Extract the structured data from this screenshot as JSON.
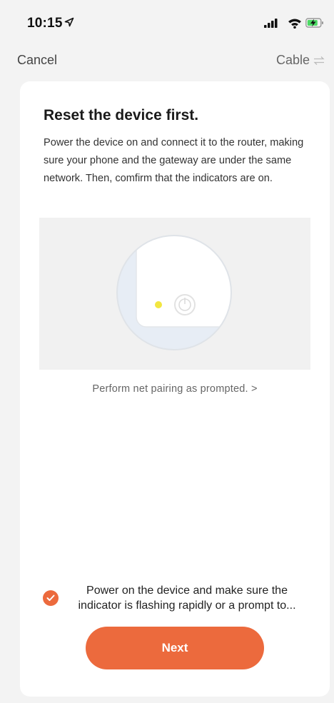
{
  "status_bar": {
    "time": "10:15",
    "location_icon": "location-arrow-icon",
    "signal_icon": "cellular-signal-icon",
    "wifi_icon": "wifi-icon",
    "battery_icon": "battery-charging-icon"
  },
  "nav": {
    "cancel_label": "Cancel",
    "cable_label": "Cable",
    "cable_icon": "switch-arrows-icon"
  },
  "card": {
    "title": "Reset the device first.",
    "description": "Power the device on and connect it to the router, making sure your phone and the gateway are under the same network. Then, comfirm that the indicators are on.",
    "pairing_link": "Perform net pairing as prompted. >",
    "confirm_text": "Power on the device and make sure the indicator is flashing rapidly or a prompt to...",
    "confirm_checked": true,
    "next_label": "Next"
  },
  "colors": {
    "accent": "#ec6a3d",
    "indicator_light": "#f2e640",
    "background": "#f3f3f3",
    "card": "#ffffff"
  }
}
